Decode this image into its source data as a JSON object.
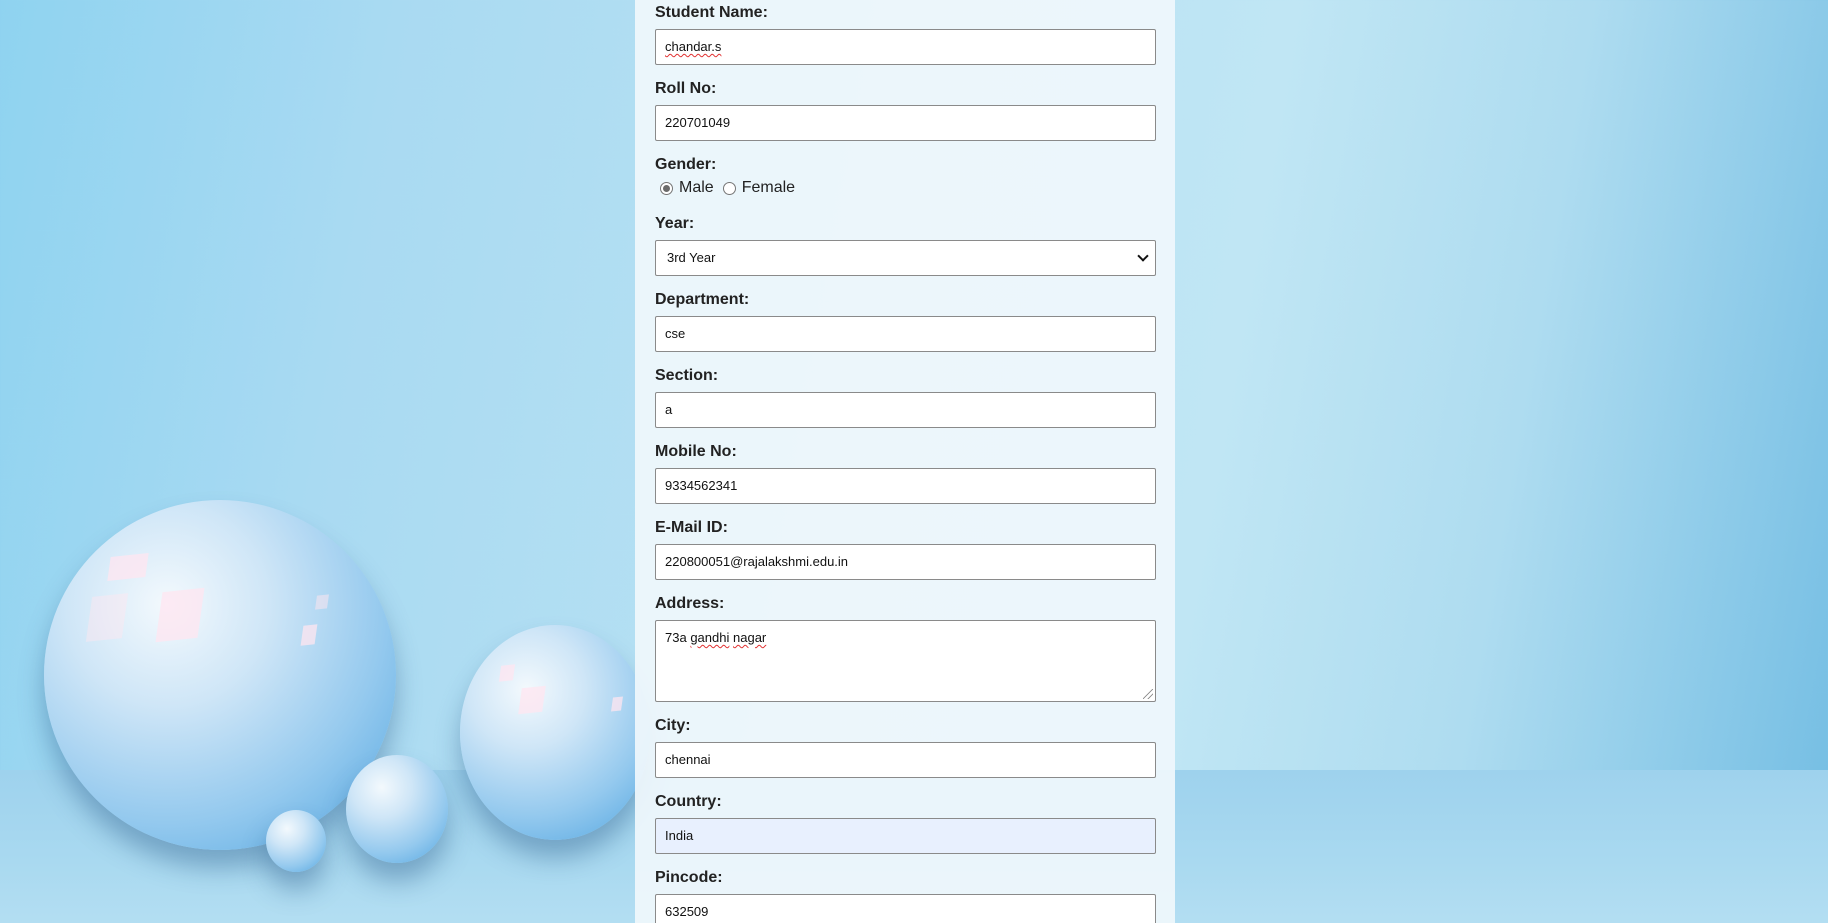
{
  "form": {
    "student_name": {
      "label": "Student Name:",
      "value": "chandar.s"
    },
    "roll_no": {
      "label": "Roll No:",
      "value": "220701049"
    },
    "gender": {
      "label": "Gender:",
      "options": [
        "Male",
        "Female"
      ],
      "selected": "Male"
    },
    "year": {
      "label": "Year:",
      "value": "3rd Year"
    },
    "department": {
      "label": "Department:",
      "value": "cse"
    },
    "section": {
      "label": "Section:",
      "value": "a"
    },
    "mobile": {
      "label": "Mobile No:",
      "value": "9334562341"
    },
    "email": {
      "label": "E-Mail ID:",
      "value": "220800051@rajalakshmi.edu.in"
    },
    "address": {
      "label": "Address:",
      "value_parts": [
        "73a",
        "gandhi",
        "nagar"
      ]
    },
    "city": {
      "label": "City:",
      "value": "chennai"
    },
    "country": {
      "label": "Country:",
      "value": "India"
    },
    "pincode": {
      "label": "Pincode:",
      "value": "632509"
    }
  },
  "colors": {
    "autofill_bg": "#e8f0fe",
    "panel_bg": "#f0f7fc",
    "spellcheck_underline": "#e03030"
  }
}
